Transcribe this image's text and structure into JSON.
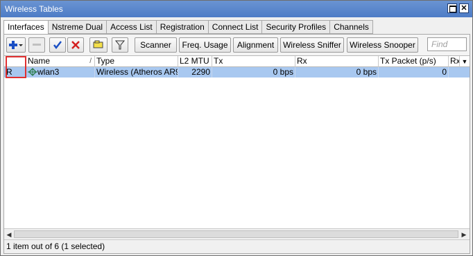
{
  "window": {
    "title": "Wireless Tables",
    "maximize_icon": "maximize-icon",
    "close_glyph": "✕"
  },
  "tabs": [
    {
      "label": "Interfaces",
      "active": true
    },
    {
      "label": "Nstreme Dual",
      "active": false
    },
    {
      "label": "Access List",
      "active": false
    },
    {
      "label": "Registration",
      "active": false
    },
    {
      "label": "Connect List",
      "active": false
    },
    {
      "label": "Security Profiles",
      "active": false
    },
    {
      "label": "Channels",
      "active": false
    }
  ],
  "toolbar": {
    "icons": [
      "add-icon",
      "remove-icon",
      "enable-icon",
      "disable-icon",
      "comment-icon",
      "filter-icon"
    ],
    "buttons": {
      "scanner": "Scanner",
      "freq_usage": "Freq. Usage",
      "alignment": "Alignment",
      "wireless_sniffer": "Wireless Sniffer",
      "wireless_snooper": "Wireless Snooper"
    },
    "find_placeholder": "Find"
  },
  "table": {
    "columns": [
      "",
      "Name",
      "Type",
      "L2 MTU",
      "Tx",
      "Rx",
      "Tx Packet (p/s)",
      "Rx"
    ],
    "sort_indicator": "/",
    "column_menu_glyph": "▼",
    "rows": [
      {
        "flag": "R",
        "name": "wlan3",
        "type": "Wireless (Atheros AR9...",
        "l2_mtu": "2290",
        "tx": "0 bps",
        "rx": "0 bps",
        "tx_packet": "0",
        "rx_packet": "",
        "icon": "wireless-interface-icon",
        "selected": true
      }
    ]
  },
  "scroll": {
    "left_glyph": "◀",
    "right_glyph": "▶"
  },
  "status": {
    "text": "1 item out of 6 (1 selected)"
  },
  "colors": {
    "titlebar": "#4d7cc6",
    "selected_row": "#a8c8f0",
    "highlight_box": "#e03030",
    "enable_check": "#1a4fc4",
    "disable_x": "#d42020"
  }
}
